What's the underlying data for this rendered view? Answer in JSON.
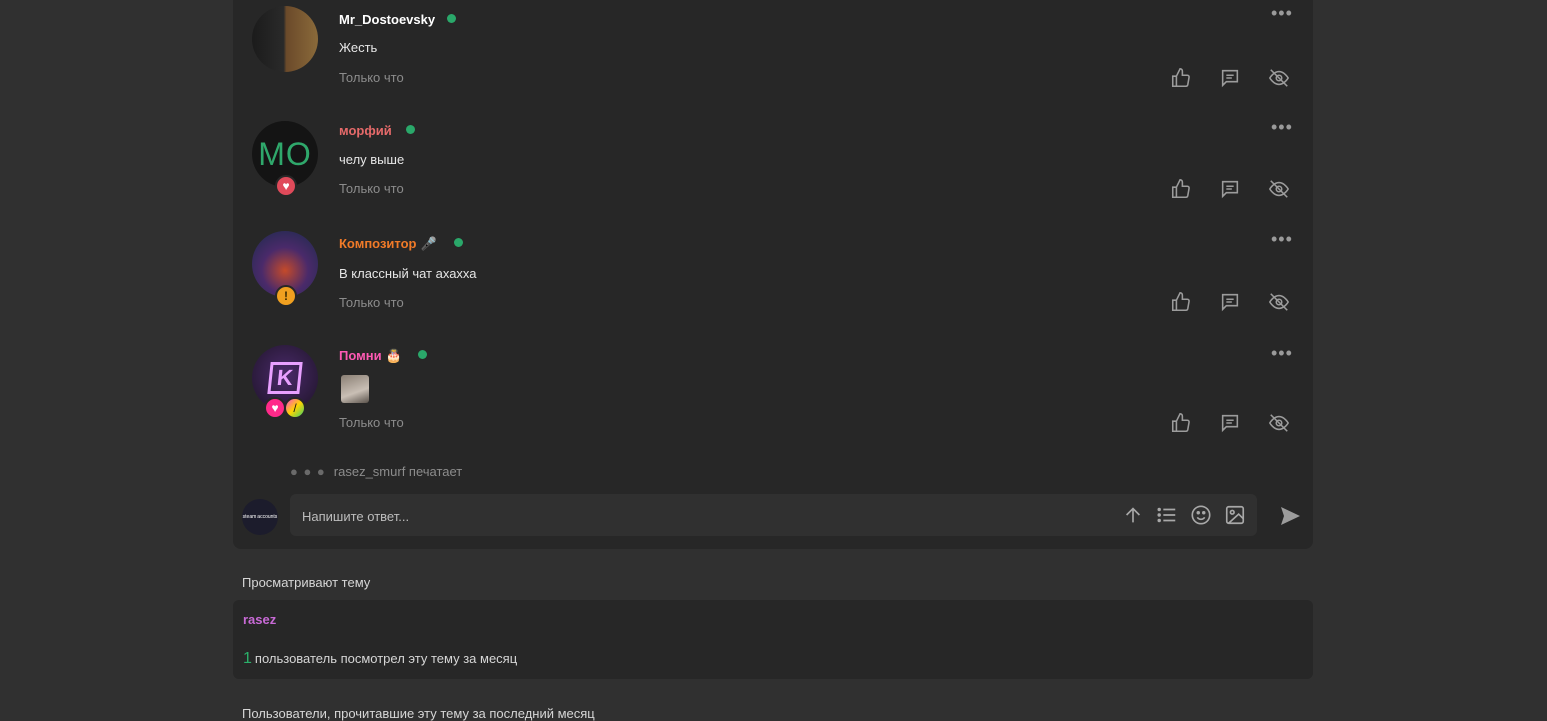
{
  "comments": [
    {
      "username": "Mr_Dostoevsky",
      "decoration": "",
      "message": "Жесть",
      "time": "Только что"
    },
    {
      "username": "морфий",
      "decoration": "",
      "avatar_text": "МО",
      "message": "челу выше",
      "time": "Только что"
    },
    {
      "username": "Композитор",
      "decoration": "🎤",
      "message": "В классный чат ахахха",
      "time": "Только что"
    },
    {
      "username": "Помни",
      "decoration": "🎂",
      "message": "",
      "time": "Только что"
    }
  ],
  "typing": {
    "text": "rasez_smurf печатает"
  },
  "reply": {
    "placeholder": "Напишите ответ...",
    "self_avatar_lines": [
      "steam",
      "accounts"
    ]
  },
  "viewers": {
    "title": "Просматривают тему",
    "name": "rasez",
    "count": "1",
    "count_text": "пользователь посмотрел эту тему за месяц"
  },
  "readers": {
    "title": "Пользователи, прочитавшие эту тему за последний месяц"
  },
  "colors": {
    "online": "#2aa86a",
    "panel": "#272727",
    "background": "#303030"
  }
}
